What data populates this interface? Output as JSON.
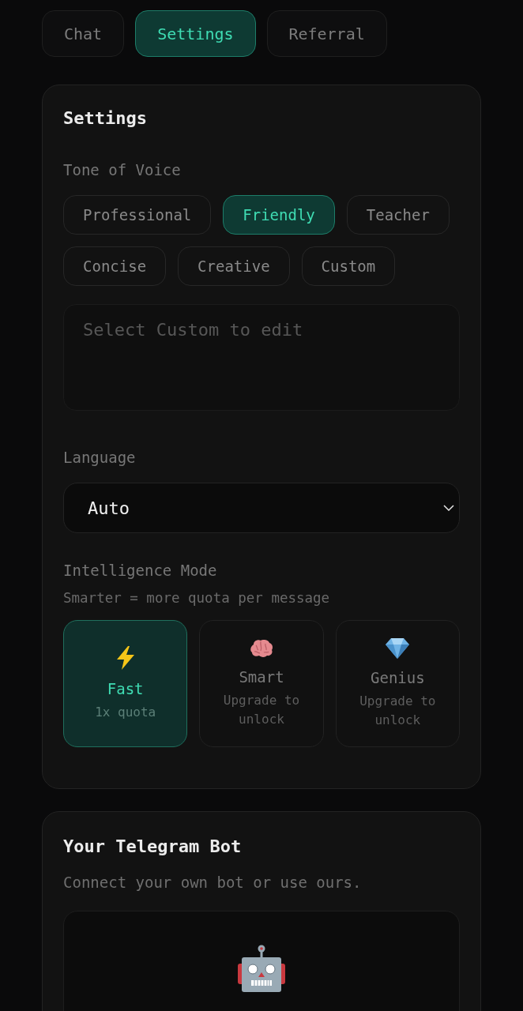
{
  "tabs": [
    {
      "label": "Chat",
      "selected": false
    },
    {
      "label": "Settings",
      "selected": true
    },
    {
      "label": "Referral",
      "selected": false
    }
  ],
  "settings": {
    "title": "Settings",
    "tone": {
      "label": "Tone of Voice",
      "options": [
        {
          "label": "Professional",
          "selected": false
        },
        {
          "label": "Friendly",
          "selected": true
        },
        {
          "label": "Teacher",
          "selected": false
        },
        {
          "label": "Concise",
          "selected": false
        },
        {
          "label": "Creative",
          "selected": false
        },
        {
          "label": "Custom",
          "selected": false
        }
      ],
      "custom_field": {
        "placeholder": "Select Custom to edit"
      }
    },
    "language": {
      "label": "Language",
      "value": "Auto"
    },
    "intelligence": {
      "label": "Intelligence Mode",
      "hint": "Smarter = more quota per message",
      "modes": [
        {
          "name": "Fast",
          "note": "1x quota",
          "selected": true
        },
        {
          "name": "Smart",
          "note": "Upgrade to unlock",
          "selected": false
        },
        {
          "name": "Genius",
          "note": "Upgrade to unlock",
          "selected": false
        }
      ]
    }
  },
  "telegram": {
    "title": "Your Telegram Bot",
    "subtitle": "Connect your own bot or use ours."
  }
}
